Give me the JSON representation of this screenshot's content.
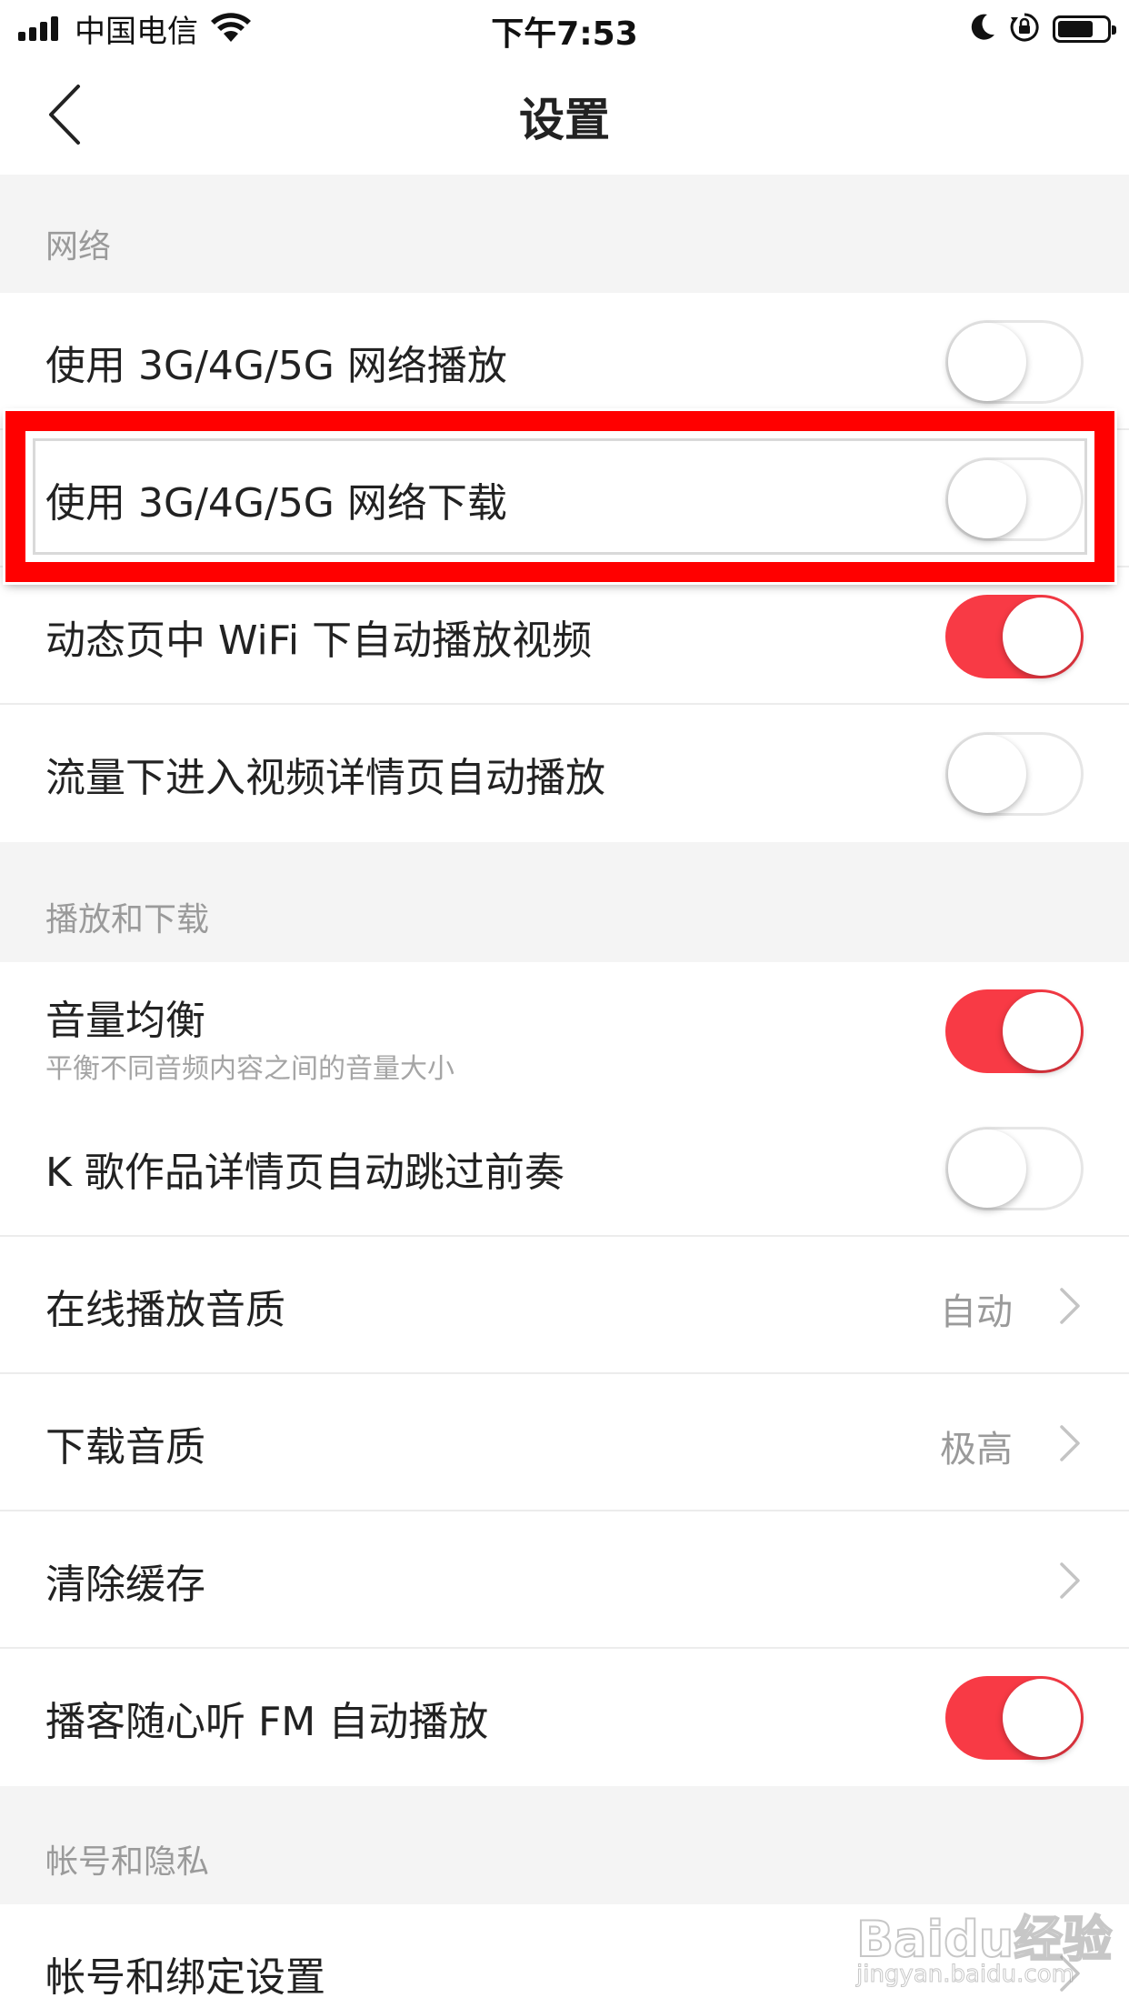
{
  "status_bar": {
    "carrier": "中国电信",
    "time": "下午7:53"
  },
  "nav": {
    "title": "设置"
  },
  "sections": [
    {
      "header": "网络",
      "rows": [
        {
          "title": "使用 3G/4G/5G 网络播放",
          "type": "toggle",
          "on": false
        },
        {
          "title": "使用 3G/4G/5G 网络下载",
          "type": "toggle",
          "on": false,
          "highlighted": true
        },
        {
          "title": "动态页中 WiFi 下自动播放视频",
          "type": "toggle",
          "on": true
        },
        {
          "title": "流量下进入视频详情页自动播放",
          "type": "toggle",
          "on": false
        }
      ]
    },
    {
      "header": "播放和下载",
      "rows": [
        {
          "title": "音量均衡",
          "subtitle": "平衡不同音频内容之间的音量大小",
          "type": "toggle",
          "on": true
        },
        {
          "title": "K 歌作品详情页自动跳过前奏",
          "type": "toggle",
          "on": false
        },
        {
          "title": "在线播放音质",
          "type": "link",
          "value": "自动"
        },
        {
          "title": "下载音质",
          "type": "link",
          "value": "极高"
        },
        {
          "title": "清除缓存",
          "type": "link"
        },
        {
          "title": "播客随心听 FM 自动播放",
          "type": "toggle",
          "on": true
        }
      ]
    },
    {
      "header": "帐号和隐私",
      "rows": [
        {
          "title": "帐号和绑定设置",
          "type": "link"
        }
      ]
    }
  ],
  "watermark": {
    "brand": "Baidu经验",
    "url": "jingyan.baidu.com"
  },
  "colors": {
    "accent_red": "#f83a45",
    "highlight_red": "#ff0000",
    "header_text": "#9a9a9a"
  }
}
